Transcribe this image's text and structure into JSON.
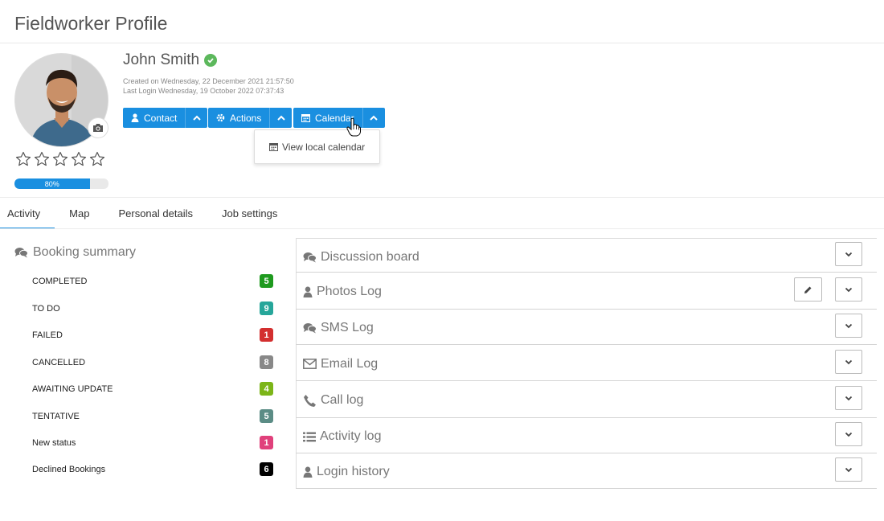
{
  "page": {
    "title": "Fieldworker Profile"
  },
  "profile": {
    "name": "John Smith",
    "created": "Created on Wednesday, 22 December 2021 21:57:50",
    "last_login": "Last Login Wednesday, 19 October 2022 07:37:43",
    "rating": 0,
    "rating_max": 5,
    "completion_percent": 80,
    "completion_label": "80%"
  },
  "actions": {
    "contact_label": "Contact",
    "actions_label": "Actions",
    "calendar_label": "Calendar",
    "calendar_menu": [
      {
        "label": "View local calendar"
      }
    ]
  },
  "tabs": [
    {
      "label": "Activity",
      "active": true
    },
    {
      "label": "Map",
      "active": false
    },
    {
      "label": "Personal details",
      "active": false
    },
    {
      "label": "Job settings",
      "active": false
    }
  ],
  "booking_summary": {
    "title": "Booking summary",
    "statuses": [
      {
        "label": "COMPLETED",
        "count": "5",
        "color": "#1e9a1e"
      },
      {
        "label": "TO DO",
        "count": "9",
        "color": "#26a69a"
      },
      {
        "label": "FAILED",
        "count": "1",
        "color": "#d32f2f"
      },
      {
        "label": "CANCELLED",
        "count": "8",
        "color": "#888888"
      },
      {
        "label": "AWAITING UPDATE",
        "count": "4",
        "color": "#7cb518"
      },
      {
        "label": "TENTATIVE",
        "count": "5",
        "color": "#5b8c85"
      },
      {
        "label": "New status",
        "count": "1",
        "color": "#e0407b"
      },
      {
        "label": "Declined Bookings",
        "count": "6",
        "color": "#000000"
      }
    ]
  },
  "panels": [
    {
      "title": "Discussion board",
      "icon": "comments-icon",
      "editable": false
    },
    {
      "title": "Photos Log",
      "icon": "user-icon",
      "editable": true
    },
    {
      "title": "SMS Log",
      "icon": "comments-icon",
      "editable": false
    },
    {
      "title": "Email Log",
      "icon": "envelope-icon",
      "editable": false
    },
    {
      "title": "Call log",
      "icon": "phone-icon",
      "editable": false
    },
    {
      "title": "Activity log",
      "icon": "list-icon",
      "editable": false
    },
    {
      "title": "Login history",
      "icon": "user-icon",
      "editable": false
    }
  ],
  "colors": {
    "primary": "#1a8fe0",
    "verified": "#5cb85c"
  }
}
